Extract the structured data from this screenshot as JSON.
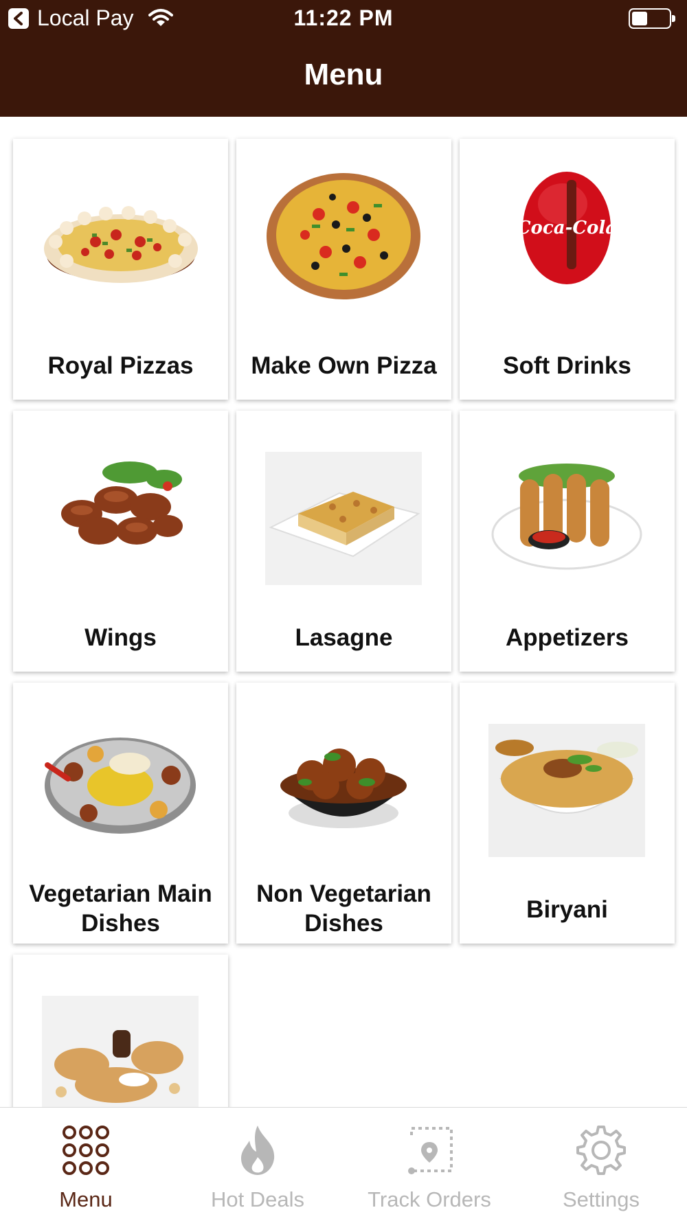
{
  "status_bar": {
    "carrier": "Local Pay",
    "time": "11:22 PM"
  },
  "header": {
    "title": "Menu"
  },
  "menu_items": [
    {
      "label": "Royal Pizzas",
      "icon": "royal-pizza-image"
    },
    {
      "label": "Make Own Pizza",
      "icon": "pizza-image"
    },
    {
      "label": "Soft Drinks",
      "icon": "coca-cola-logo"
    },
    {
      "label": "Wings",
      "icon": "chicken-wings-image"
    },
    {
      "label": "Lasagne",
      "icon": "lasagne-image"
    },
    {
      "label": "Appetizers",
      "icon": "mozzarella-sticks-image"
    },
    {
      "label": "Vegetarian Main Dishes",
      "icon": "thali-image"
    },
    {
      "label": "Non Vegetarian Dishes",
      "icon": "curry-bowl-image"
    },
    {
      "label": "Biryani",
      "icon": "biryani-image"
    },
    {
      "label": "",
      "icon": "breads-image"
    }
  ],
  "coca_cola_logo_text": "Coca-Cola",
  "tabs": [
    {
      "label": "Menu",
      "icon": "grid-dots-icon",
      "active": true
    },
    {
      "label": "Hot Deals",
      "icon": "flame-icon",
      "active": false
    },
    {
      "label": "Track Orders",
      "icon": "route-pin-icon",
      "active": false
    },
    {
      "label": "Settings",
      "icon": "gear-icon",
      "active": false
    }
  ],
  "colors": {
    "header_bg": "#3b170a",
    "active_tab": "#5a2716",
    "inactive_tab": "#b7b7b7"
  }
}
